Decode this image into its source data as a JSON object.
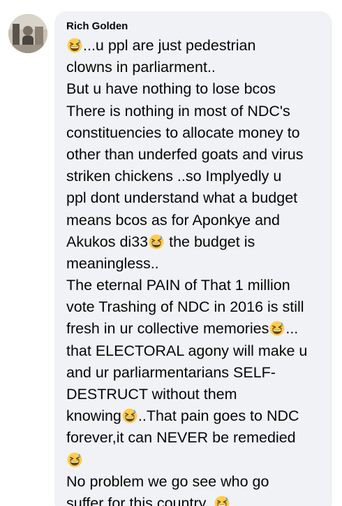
{
  "comment": {
    "author": "Rich Golden",
    "lines": [
      {
        "pre": "",
        "emoji": true,
        "post": "...u ppl are just pedestrian"
      },
      {
        "pre": "clowns in parliarment..",
        "emoji": false,
        "post": ""
      },
      {
        "pre": "But u have nothing to lose bcos",
        "emoji": false,
        "post": ""
      },
      {
        "pre": "There is nothing in most of NDC's",
        "emoji": false,
        "post": ""
      },
      {
        "pre": "constituencies to allocate money to",
        "emoji": false,
        "post": ""
      },
      {
        "pre": "other than underfed goats and virus",
        "emoji": false,
        "post": ""
      },
      {
        "pre": "striken chickens ..so Implyedly u",
        "emoji": false,
        "post": ""
      },
      {
        "pre": "ppl dont understand what a budget",
        "emoji": false,
        "post": ""
      },
      {
        "pre": "means bcos as for Aponkye and",
        "emoji": false,
        "post": ""
      },
      {
        "pre": "Akukos di33",
        "emoji": true,
        "post": " the budget is"
      },
      {
        "pre": "meaningless..",
        "emoji": false,
        "post": ""
      },
      {
        "pre": "The eternal PAIN of That 1 million",
        "emoji": false,
        "post": ""
      },
      {
        "pre": "vote Trashing of NDC in 2016 is still",
        "emoji": false,
        "post": ""
      },
      {
        "pre": "fresh in ur collective memories",
        "emoji": true,
        "post": "..."
      },
      {
        "pre": "that ELECTORAL agony will make u",
        "emoji": false,
        "post": ""
      },
      {
        "pre": "and ur parliarmentarians SELF-",
        "emoji": false,
        "post": ""
      },
      {
        "pre": "DESTRUCT without them",
        "emoji": false,
        "post": ""
      },
      {
        "pre": "knowing",
        "emoji": true,
        "post": "..That pain goes to NDC"
      },
      {
        "pre": "forever,it can NEVER be remedied",
        "emoji": false,
        "post": ""
      },
      {
        "pre": "",
        "emoji": true,
        "post": ""
      },
      {
        "pre": "No problem we go see who go",
        "emoji": false,
        "post": ""
      },
      {
        "pre": "suffer for this country..",
        "emoji": true,
        "post": ""
      }
    ],
    "emoji_icon": "grinning-squinting-face-with-sweat-icon"
  },
  "colors": {
    "bubble": "#f0f2f5",
    "text": "#050505",
    "emoji_face": "#ffcc4d",
    "emoji_sweat": "#5dadec"
  }
}
